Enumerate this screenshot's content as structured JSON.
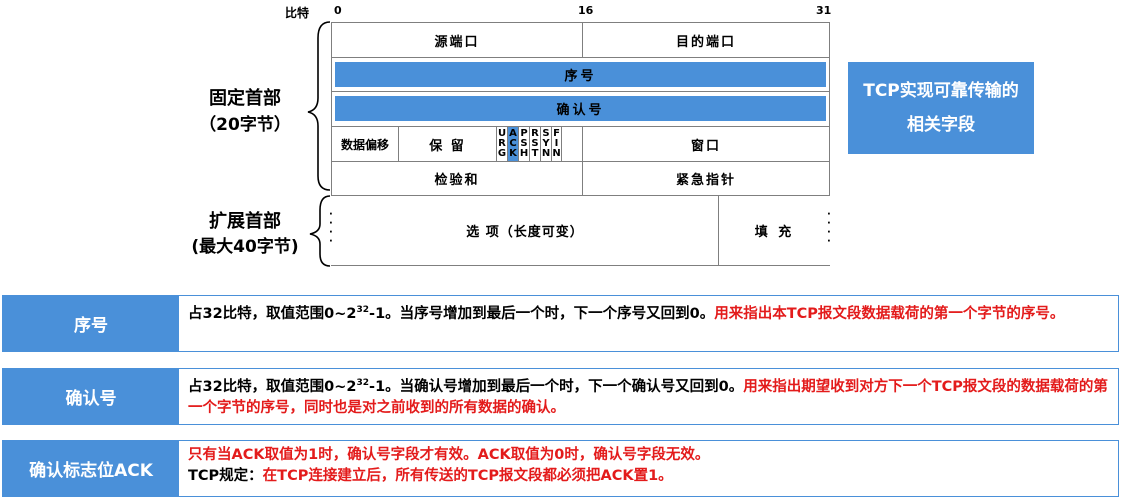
{
  "diagram": {
    "bit_label": "比特",
    "bit_0": "0",
    "bit_16": "16",
    "bit_31": "31",
    "fixed_header_line1": "固定首部",
    "fixed_header_line2": "（20字节）",
    "ext_header_line1": "扩展首部",
    "ext_header_line2": "(最大40字节)",
    "src_port": "源端口",
    "dst_port": "目的端口",
    "seq": "序号",
    "ack_num": "确认号",
    "data_offset": "数据偏移",
    "reserved": "保 留",
    "flags": [
      {
        "letters": [
          "U",
          "R",
          "G"
        ]
      },
      {
        "letters": [
          "A",
          "C",
          "K"
        ]
      },
      {
        "letters": [
          "P",
          "S",
          "H"
        ]
      },
      {
        "letters": [
          "R",
          "S",
          "T"
        ]
      },
      {
        "letters": [
          "S",
          "Y",
          "N"
        ]
      },
      {
        "letters": [
          "F",
          "I",
          "N"
        ]
      }
    ],
    "window": "窗口",
    "checksum": "检验和",
    "urgent_ptr": "紧急指针",
    "options": "选 项（长度可变）",
    "padding": "填 充"
  },
  "callout": {
    "line1": "TCP实现可靠传输的",
    "line2": "相关字段"
  },
  "info_rows": [
    {
      "tag": "序号",
      "text_a": "占32比特，取值范围0~2",
      "sup": "32",
      "text_b": "-1。当序号增加到最后一个时，下一个序号又回到0。",
      "text_red": "用来指出本TCP报文段数据载荷的第一个字节的序号。"
    },
    {
      "tag": "确认号",
      "text_a": "占32比特，取值范围0~2",
      "sup": "32",
      "text_b": "-1。当确认号增加到最后一个时，下一个确认号又回到0。",
      "text_red": "用来指出期望收到对方下一个TCP报文段的数据载荷的第一个字节的序号，同时也是对之前收到的所有数据的确认。"
    },
    {
      "tag": "确认标志位ACK",
      "text_a": "只有当ACK取值为1时，确认号字段才有效。ACK取值为0时，确认号字段无效。",
      "rule_prefix": "TCP规定：",
      "rule_red": "在TCP连接建立后，所有传送的TCP报文段都必须把ACK置1。"
    }
  ],
  "colors": {
    "accent_blue": "#4a90d9",
    "highlight_red": "#e31b1b",
    "border_gray": "#7f7f7f"
  }
}
